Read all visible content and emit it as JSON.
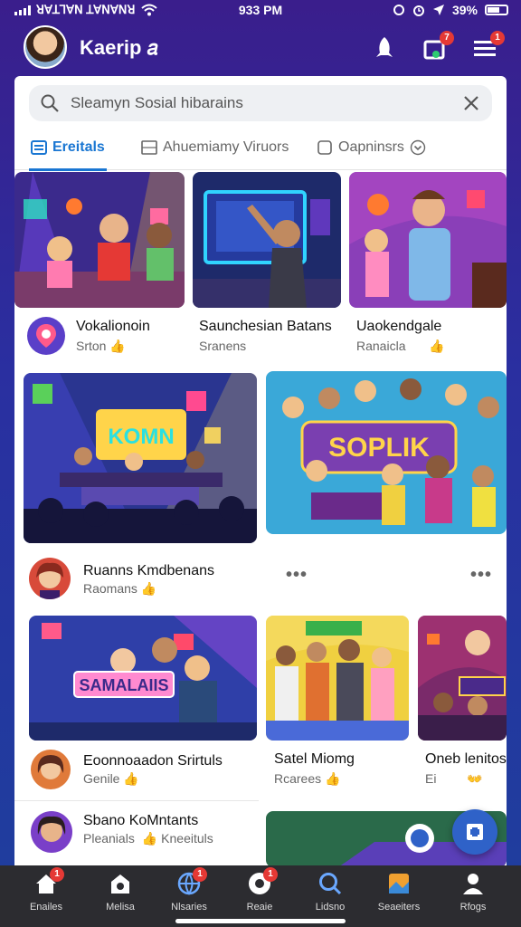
{
  "status_bar": {
    "carrier": "ꓤꓯꓕꓶꓯꓠ ꓕꓯꓠꓯꓠꓤ",
    "time": "933 PM",
    "battery": "39%"
  },
  "header": {
    "title": "Kaerip 𝑎",
    "notifications_badge": "7",
    "menu_badge": "1"
  },
  "search": {
    "value": "Sleamyn Sosial hibarains"
  },
  "tabs": [
    {
      "label": "Ereitals",
      "icon": "list-icon"
    },
    {
      "label": "Ahuemiamy Viruors",
      "icon": "image-icon"
    },
    {
      "label": "Oapninsrs",
      "icon": "chevron-down-icon"
    }
  ],
  "row1": [
    {
      "title": "Vokalionoin",
      "sub": "Srton"
    },
    {
      "title": "Saunchesian Batans",
      "sub": "Sranens"
    },
    {
      "title": "Uaokendgale",
      "sub": "Ranaicla"
    }
  ],
  "row2": {
    "banner_left": "KOMN",
    "banner_right": "SOPLIK",
    "title": "Ruanns Kmdbenans",
    "sub": "Raomans"
  },
  "row3": [
    {
      "title": "Eoonnoaadon Srirtuls",
      "sub": "Genile",
      "banner": "SAMALAIIS"
    },
    {
      "title": "Satel Miomg",
      "sub": "Rcarees"
    },
    {
      "title": "Oneb lenitos",
      "sub": "Ei"
    }
  ],
  "row4": {
    "title": "Sbano KoMntants",
    "sub": "Pleanials",
    "sub2": "Kneeituls"
  },
  "bottom_nav": [
    {
      "label": "Enailes",
      "icon": "home-icon",
      "badge": "1"
    },
    {
      "label": "Melisa",
      "icon": "house-icon"
    },
    {
      "label": "Nlsaries",
      "icon": "globe-icon",
      "badge": "1"
    },
    {
      "label": "Reaie",
      "icon": "camera-icon",
      "badge": "1"
    },
    {
      "label": "Lidsno",
      "icon": "search-icon"
    },
    {
      "label": "Seaeiters",
      "icon": "gallery-icon"
    },
    {
      "label": "Rfogs",
      "icon": "profile-icon"
    }
  ],
  "colors": {
    "accent": "#1976d2",
    "header_bg": "#3a1e8c",
    "nav_bg": "#2c2c30",
    "badge": "#e53935",
    "thumb": "#f2b400"
  }
}
